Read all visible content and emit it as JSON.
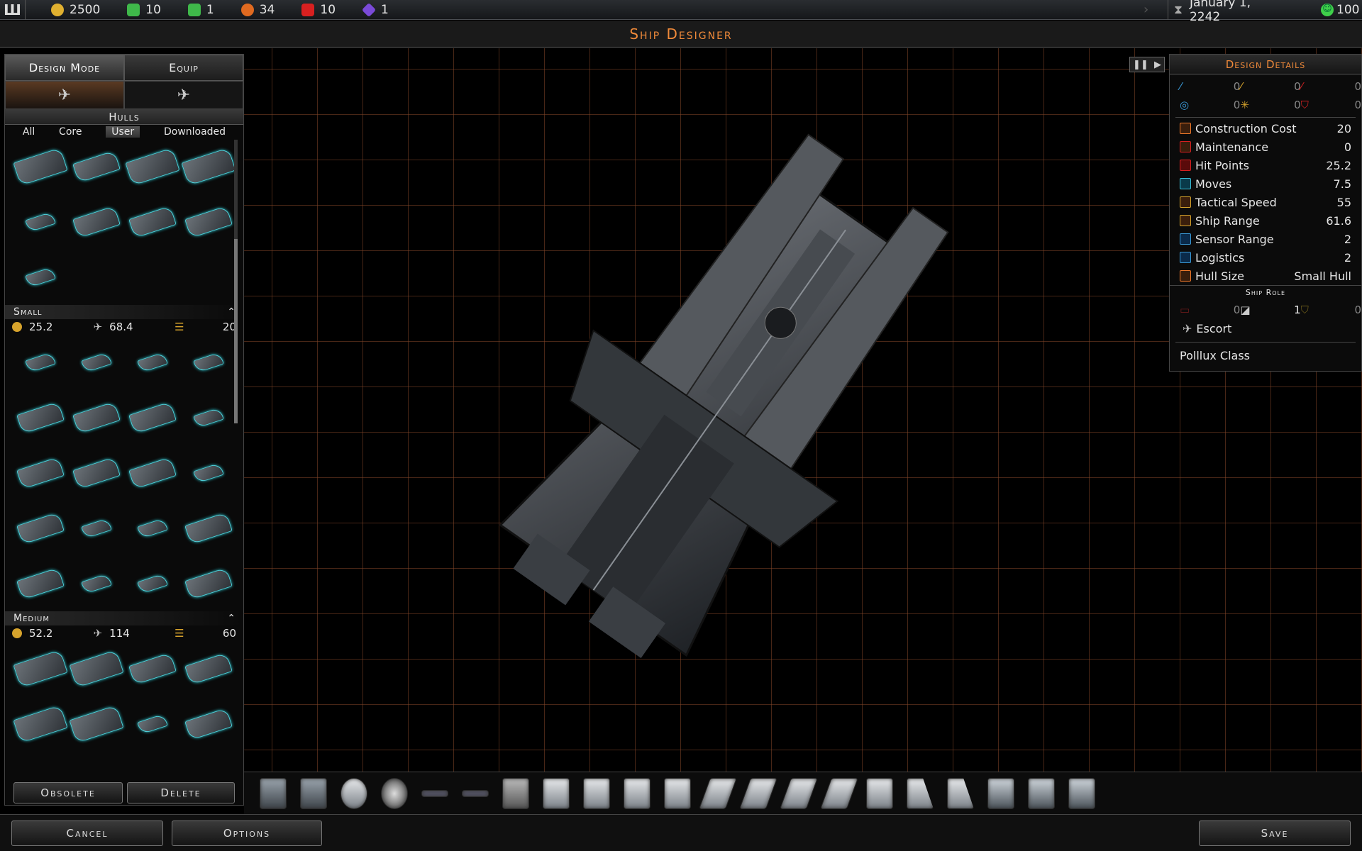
{
  "topbar": {
    "logo": "Ш",
    "resources": [
      {
        "icon": "credits-icon",
        "color": "#e0b030",
        "value": "2500"
      },
      {
        "icon": "influence-icon",
        "color": "#3fb84a",
        "value": "10"
      },
      {
        "icon": "food-icon",
        "color": "#3fb84a",
        "value": "1"
      },
      {
        "icon": "industry-icon",
        "color": "#e06a20",
        "value": "34"
      },
      {
        "icon": "military-icon",
        "color": "#d82020",
        "value": "10"
      },
      {
        "icon": "research-icon",
        "color": "#7a4ad8",
        "value": "1"
      }
    ],
    "date": "January 1, 2242",
    "approval": "100"
  },
  "title": "Ship Designer",
  "left": {
    "tabs": {
      "design_mode": "Design Mode",
      "equip": "Equip"
    },
    "hulls_header": "Hulls",
    "filters": [
      "All",
      "Core",
      "User",
      "Downloaded"
    ],
    "active_filter": "User",
    "small": {
      "label": "Small",
      "cost": "25.2",
      "range": "68.4",
      "logistics": "20"
    },
    "medium": {
      "label": "Medium",
      "cost": "52.2",
      "range": "114",
      "logistics": "60"
    },
    "obsolete": "Obsolete",
    "delete": "Delete"
  },
  "details": {
    "header": "Design Details",
    "weapons": [
      {
        "icon": "beam-weapon-icon",
        "value": "0"
      },
      {
        "icon": "kinetic-weapon-icon",
        "value": "0"
      },
      {
        "icon": "missile-weapon-icon",
        "value": "0"
      },
      {
        "icon": "shield-defense-icon",
        "value": "0"
      },
      {
        "icon": "point-defense-icon",
        "value": "0"
      },
      {
        "icon": "armor-defense-icon",
        "value": "0"
      }
    ],
    "stats": [
      {
        "icon": "construction-cost-icon",
        "label": "Construction Cost",
        "value": "20"
      },
      {
        "icon": "maintenance-icon",
        "label": "Maintenance",
        "value": "0"
      },
      {
        "icon": "hit-points-icon",
        "label": "Hit Points",
        "value": "25.2"
      },
      {
        "icon": "moves-icon",
        "label": "Moves",
        "value": "7.5"
      },
      {
        "icon": "tactical-speed-icon",
        "label": "Tactical Speed",
        "value": "55"
      },
      {
        "icon": "ship-range-icon",
        "label": "Ship Range",
        "value": "61.6"
      },
      {
        "icon": "sensor-range-icon",
        "label": "Sensor Range",
        "value": "2"
      },
      {
        "icon": "logistics-icon",
        "label": "Logistics",
        "value": "2"
      },
      {
        "icon": "hull-size-icon",
        "label": "Hull Size",
        "value": "Small Hull"
      }
    ],
    "ship_role_header": "Ship Role",
    "role_counts": [
      {
        "icon": "combat-role-icon",
        "value": "0"
      },
      {
        "icon": "escort-role-icon",
        "value": "1"
      },
      {
        "icon": "support-role-icon",
        "value": "0"
      }
    ],
    "role": "Escort",
    "class_name": "Polllux Class"
  },
  "bottom": {
    "cancel": "Cancel",
    "options": "Options",
    "save": "Save"
  }
}
